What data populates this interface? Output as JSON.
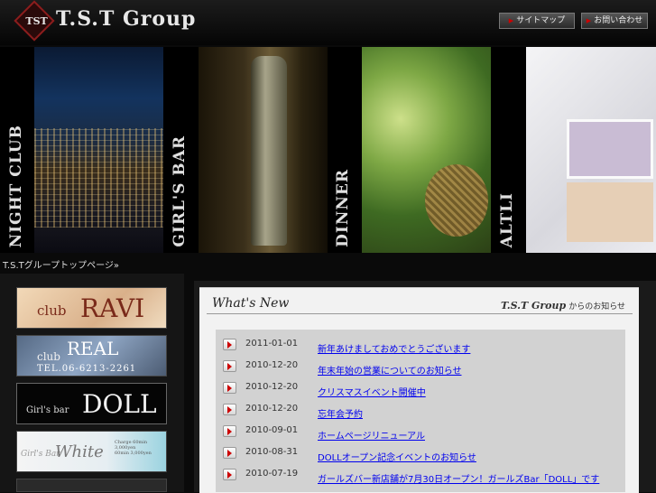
{
  "header": {
    "logo_mark": "TST",
    "logo_text": "T.S.T Group",
    "nav": [
      {
        "label": "サイトマップ",
        "icon": "arrow-right-icon"
      },
      {
        "label": "お問い合わせ",
        "icon": "arrow-right-icon"
      }
    ]
  },
  "banner": {
    "panels": [
      {
        "label": "NIGHT CLUB"
      },
      {
        "label": "GIRL'S BAR"
      },
      {
        "label": "DINNER"
      },
      {
        "label": "ALTLI"
      }
    ]
  },
  "breadcrumb": "T.S.Tグループトップページ»",
  "clubs": [
    {
      "word1": "club",
      "word2": "RAVI"
    },
    {
      "word1": "club",
      "word2": "REAL",
      "phone": "TEL.06-6213-2261"
    },
    {
      "word1": "Girl's bar",
      "word2": "DOLL"
    },
    {
      "word1": "Girl's Bar",
      "word2": "White",
      "lines": [
        "Charge 60min 3,000yen",
        "60min 3,000yen"
      ]
    }
  ],
  "whats_new": {
    "title": "What's New",
    "subtitle_brand": "T.S.T Group",
    "subtitle_text": "からのお知らせ"
  },
  "news": [
    {
      "date": "2011-01-01",
      "title": "新年あけましておめでとうございます"
    },
    {
      "date": "2010-12-20",
      "title": "年末年始の営業についてのお知らせ"
    },
    {
      "date": "2010-12-20",
      "title": "クリスマスイベント開催中"
    },
    {
      "date": "2010-12-20",
      "title": "忘年会予約"
    },
    {
      "date": "2010-09-01",
      "title": "ホームページリニューアル"
    },
    {
      "date": "2010-08-31",
      "title": "DOLLオープン記念イベントのお知らせ"
    },
    {
      "date": "2010-07-19",
      "title": "ガールズバー新店舗が7月30日オープン！ガールズBar「DOLL」です"
    }
  ]
}
